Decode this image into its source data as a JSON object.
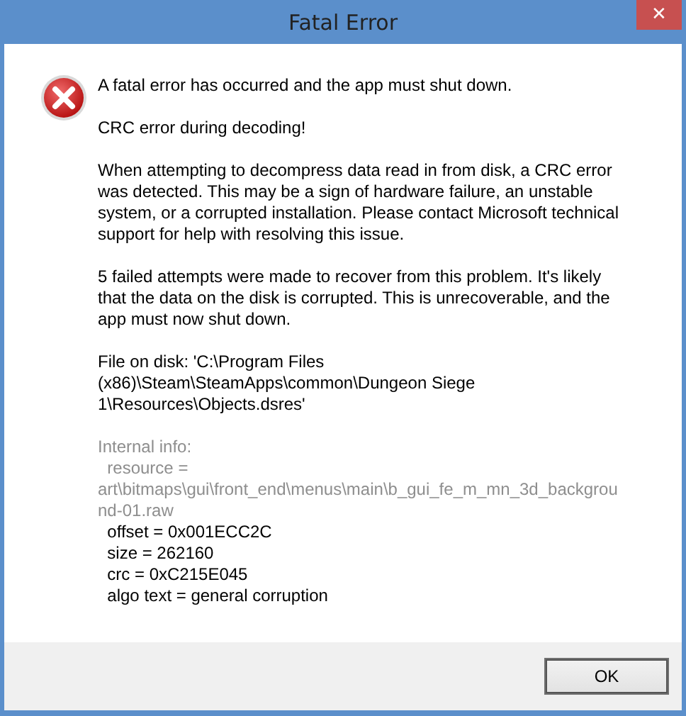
{
  "window": {
    "title": "Fatal Error",
    "close": "✕"
  },
  "paragraphs": [
    "A fatal error has occurred and the app must shut down.",
    "CRC error during decoding!",
    "When attempting to decompress data read in from disk, a CRC error\nwas detected. This may be a sign of hardware failure, an unstable\nsystem, or a corrupted installation. Please contact Microsoft technical\nsupport for help with resolving this issue.",
    "5 failed attempts were made to recover from this problem. It's likely\nthat the data on the disk is corrupted. This is unrecoverable, and the\napp must now shut down.",
    "File on disk: 'C:\\Program Files\n(x86)\\Steam\\SteamApps\\common\\Dungeon Siege\n1\\Resources\\Objects.dsres'"
  ],
  "internal_info": [
    {
      "text": "Internal info:\n  resource =\nart\\bitmaps\\gui\\front_end\\menus\\main\\b_gui_fe_m_mn_3d_backgrou\nnd-01.raw",
      "dimmed": true
    },
    {
      "text": "  offset = 0x001ECC2C",
      "dimmed": false
    },
    {
      "text": "  size = 262160",
      "dimmed": false
    },
    {
      "text": "  crc = 0xC215E045",
      "dimmed": false
    },
    {
      "text": "  algo text = general corruption",
      "dimmed": false
    }
  ],
  "buttons": [
    "OK"
  ]
}
